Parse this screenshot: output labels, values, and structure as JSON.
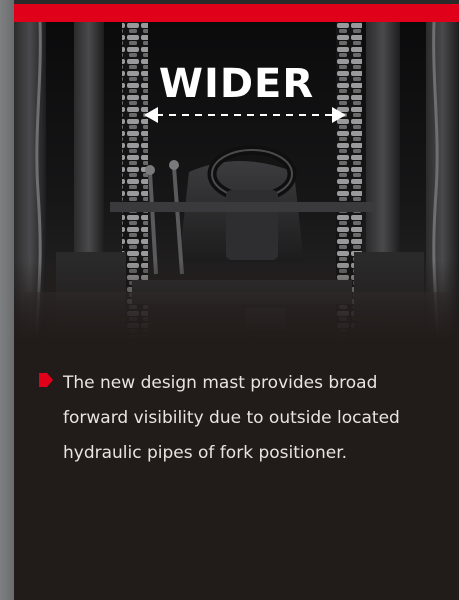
{
  "hero": {
    "headline": "WIDER"
  },
  "content": {
    "description": "The new design mast provides broad forward visibility due to outside located hydraulic pipes of fork positioner."
  },
  "colors": {
    "accent": "#e1001a",
    "card_background": "#211b19",
    "text": "#e8e4e2"
  },
  "icons": {
    "bullet": "red-pentagon-arrow-icon",
    "width_arrow": "double-headed-arrow-icon"
  }
}
